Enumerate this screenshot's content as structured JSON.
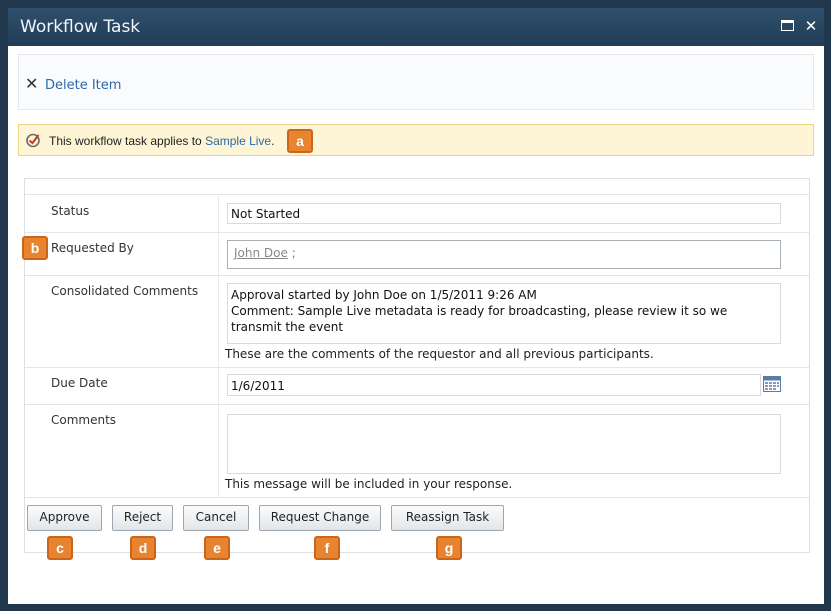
{
  "window": {
    "title": "Workflow Task",
    "maximize_icon": "maximize-icon",
    "close_icon": "close-icon",
    "close_glyph": "✕"
  },
  "toolbar": {
    "delete_icon_glyph": "✕",
    "delete_label": "Delete Item"
  },
  "status_bar": {
    "icon": "task-check-icon",
    "text_prefix": "This workflow task applies to ",
    "link_text": "Sample Live",
    "text_suffix": "."
  },
  "form": {
    "status": {
      "label": "Status",
      "value": "Not Started"
    },
    "requested_by": {
      "label": "Requested By",
      "user": "John Doe",
      "separator": ";"
    },
    "consolidated_comments": {
      "label": "Consolidated Comments",
      "line1": "Approval started by John Doe on 1/5/2011 9:26 AM",
      "line2": "Comment: Sample Live metadata is ready for broadcasting, please review it so we",
      "line3": "transmit the event",
      "hint": "These are the comments of the requestor and all previous participants."
    },
    "due_date": {
      "label": "Due Date",
      "value": "1/6/2011",
      "icon": "calendar-icon"
    },
    "comments": {
      "label": "Comments",
      "value": "",
      "hint": "This message will be included in your response."
    }
  },
  "buttons": {
    "approve": "Approve",
    "reject": "Reject",
    "cancel": "Cancel",
    "request_change": "Request Change",
    "reassign_task": "Reassign Task"
  },
  "callouts": {
    "a": "a",
    "b": "b",
    "c": "c",
    "d": "d",
    "e": "e",
    "f": "f",
    "g": "g"
  },
  "colors": {
    "title_bar": "#223d57",
    "link": "#2a6aa8",
    "status_bar_bg": "#fdf5d5",
    "callout": "#e8832f"
  }
}
